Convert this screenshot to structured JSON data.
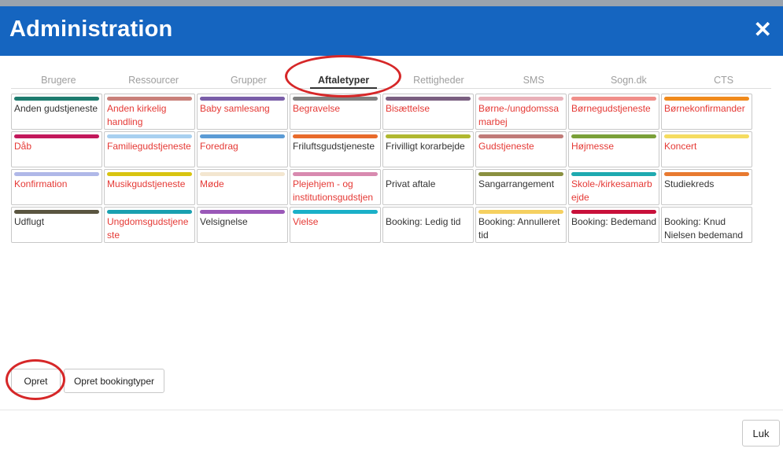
{
  "dialog": {
    "title": "Administration",
    "close_icon": "close-icon"
  },
  "tabs": [
    {
      "label": "Brugere",
      "active": false
    },
    {
      "label": "Ressourcer",
      "active": false
    },
    {
      "label": "Grupper",
      "active": false
    },
    {
      "label": "Aftaletyper",
      "active": true
    },
    {
      "label": "Rettigheder",
      "active": false
    },
    {
      "label": "SMS",
      "active": false
    },
    {
      "label": "Sogn.dk",
      "active": false
    },
    {
      "label": "CTS",
      "active": false
    }
  ],
  "appointment_types": [
    {
      "name": "Anden gudstjeneste",
      "color": "#1e7b6e",
      "red": false
    },
    {
      "name": "Anden kirkelig handling",
      "color": "#c9807a",
      "red": true
    },
    {
      "name": "Baby samlesang",
      "color": "#7a5ea8",
      "red": true
    },
    {
      "name": "Begravelse",
      "color": "#808080",
      "red": true
    },
    {
      "name": "Bisættelse",
      "color": "#7a5f80",
      "red": true
    },
    {
      "name": "Børne-/ungdomssamarbej",
      "color": "#e8b0b8",
      "red": true
    },
    {
      "name": "Børnegudstjeneste",
      "color": "#f08f8a",
      "red": true
    },
    {
      "name": "Børnekonfirmander",
      "color": "#f08a1c",
      "red": true
    },
    {
      "name": "Dåb",
      "color": "#c2185b",
      "red": true
    },
    {
      "name": "Familiegudstjeneste",
      "color": "#a8d0f0",
      "red": true
    },
    {
      "name": "Foredrag",
      "color": "#5b9bd5",
      "red": true
    },
    {
      "name": "Friluftsgudstjeneste",
      "color": "#e86a2a",
      "red": false
    },
    {
      "name": "Frivilligt korarbejde",
      "color": "#b0b830",
      "red": false
    },
    {
      "name": "Gudstjeneste",
      "color": "#c07b78",
      "red": true
    },
    {
      "name": "Højmesse",
      "color": "#7aa038",
      "red": true
    },
    {
      "name": "Koncert",
      "color": "#f5dc60",
      "red": true
    },
    {
      "name": "Konfirmation",
      "color": "#b0b8e8",
      "red": true
    },
    {
      "name": "Musikgudstjeneste",
      "color": "#d8c410",
      "red": true
    },
    {
      "name": "Møde",
      "color": "#f3e6d0",
      "red": true
    },
    {
      "name": "Plejehjem - og institutionsgudstjen",
      "color": "#d88ab0",
      "red": true
    },
    {
      "name": "Privat aftale",
      "color": "#ffffff",
      "red": false
    },
    {
      "name": "Sangarrangement",
      "color": "#8a9040",
      "red": false
    },
    {
      "name": "Skole-/kirkesamarbejde",
      "color": "#1eaab0",
      "red": true
    },
    {
      "name": "Studiekreds",
      "color": "#e87a30",
      "red": false
    },
    {
      "name": "Udflugt",
      "color": "#5a5540",
      "red": false
    },
    {
      "name": "Ungdomsgudstjeneste",
      "color": "#1aa0b0",
      "red": true
    },
    {
      "name": "Velsignelse",
      "color": "#9a58b8",
      "red": false
    },
    {
      "name": "Vielse",
      "color": "#1ab0c8",
      "red": true
    },
    {
      "name": "Booking: Ledig tid",
      "color": "#ffffff",
      "red": false
    },
    {
      "name": "Booking: Annulleret tid",
      "color": "#f5d060",
      "red": false
    },
    {
      "name": "Booking: Bedemand",
      "color": "#c8103a",
      "red": false
    },
    {
      "name": "Booking: Knud Nielsen bedemand",
      "color": "#ffffff",
      "red": false
    }
  ],
  "buttons": {
    "opret": "Opret",
    "opret_booking": "Opret bookingtyper",
    "luk": "Luk"
  }
}
